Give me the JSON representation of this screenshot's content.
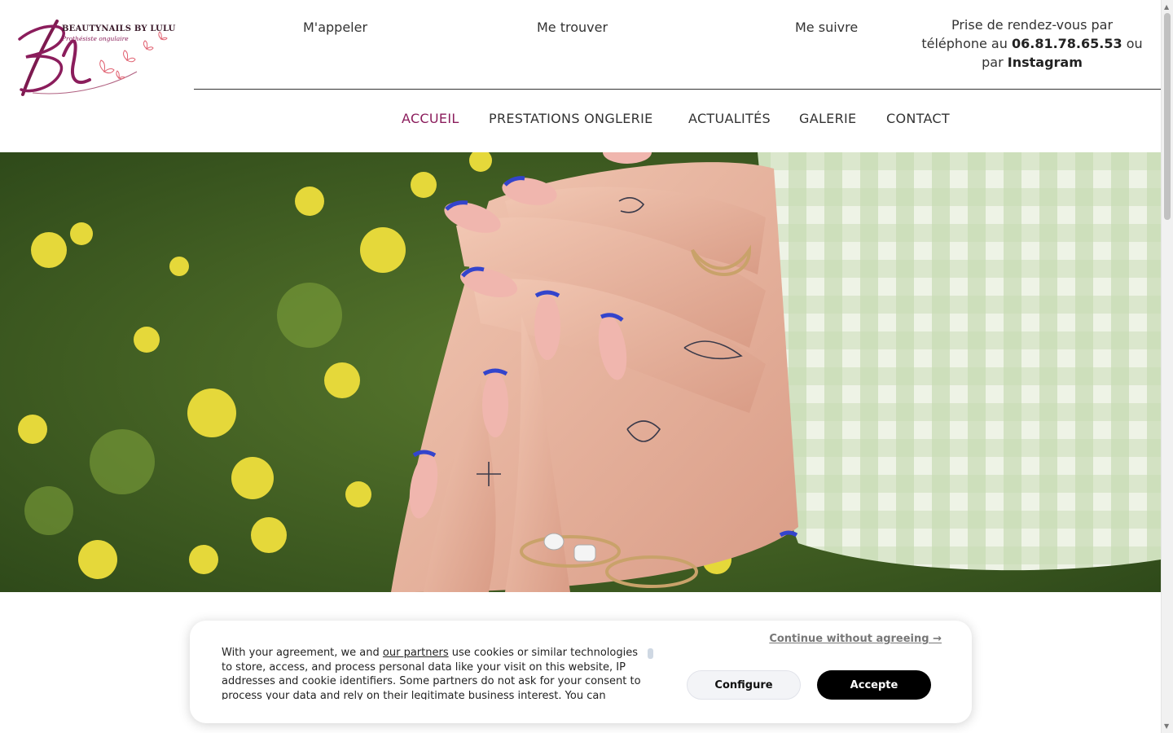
{
  "brand": {
    "name": "BEAUTYNAILS BY LULU",
    "tagline": "Prothésiste ongulaire",
    "color": "#8b1d5c"
  },
  "top_links": [
    {
      "label": "M'appeler",
      "icon": "phone-icon"
    },
    {
      "label": "Me trouver",
      "icon": "map-pin-icon"
    },
    {
      "label": "Me suivre",
      "icon": "share-icon"
    }
  ],
  "appointment": {
    "line1": "Prise de rendez-vous par",
    "line2_prefix": "téléphone au",
    "phone": "06.81.78.65.53",
    "line2_suffix": "ou",
    "line3_prefix": "par",
    "instagram": "Instagram"
  },
  "nav": {
    "items": [
      {
        "label": "ACCUEIL",
        "active": true
      },
      {
        "label": "PRESTATIONS ONGLERIE",
        "active": false
      },
      {
        "label": "ACTUALITÉS",
        "active": false
      },
      {
        "label": "GALERIE",
        "active": false
      },
      {
        "label": "CONTACT",
        "active": false
      }
    ],
    "active_color": "#8b1d5c"
  },
  "hero": {
    "image": "hands-with-blue-french-manicure-photo"
  },
  "cookie": {
    "text_before_link": "With your agreement, we and",
    "link": "our partners",
    "text_after_link": "use cookies or similar technologies to store, access, and process personal data like your visit on this website, IP addresses and cookie identifiers. Some partners do not ask for your consent to process your data and rely on their legitimate business interest. You can",
    "continue": "Continue without agreeing →",
    "configure": "Configure",
    "accept": "Accepte"
  }
}
